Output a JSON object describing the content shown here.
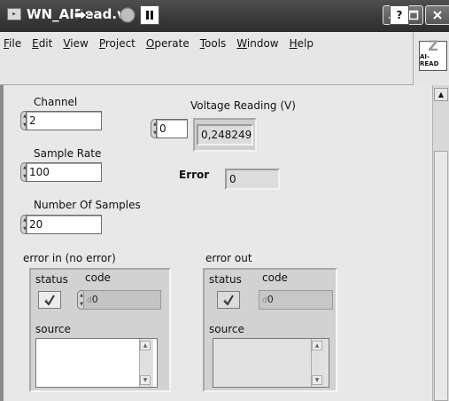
{
  "window": {
    "title": "WN_AIRead.vi",
    "app_icon_glyph": "▸"
  },
  "menu": {
    "items": [
      {
        "label": "File",
        "mnemonic": "F"
      },
      {
        "label": "Edit",
        "mnemonic": "E"
      },
      {
        "label": "View",
        "mnemonic": "V"
      },
      {
        "label": "Project",
        "mnemonic": "P"
      },
      {
        "label": "Operate",
        "mnemonic": "O"
      },
      {
        "label": "Tools",
        "mnemonic": "T"
      },
      {
        "label": "Window",
        "mnemonic": "W"
      },
      {
        "label": "Help",
        "mnemonic": "H"
      }
    ]
  },
  "toolbar": {
    "run_icon": "run-arrow-icon",
    "abort_icon": "abort-execution-icon",
    "pause_icon": "pause-icon",
    "help_glyph": "?"
  },
  "vi_icon": {
    "glyph": "Z",
    "caption": "AI-READ"
  },
  "controls": {
    "channel": {
      "label": "Channel",
      "value": "2"
    },
    "sample_rate": {
      "label": "Sample Rate",
      "value": "100"
    },
    "num_samples": {
      "label": "Number Of Samples",
      "value": "20"
    },
    "voltage": {
      "label": "Voltage Reading (V)",
      "index": "0",
      "value": "0,248249"
    },
    "error": {
      "label": "Error",
      "value": "0"
    }
  },
  "error_in": {
    "label": "error in (no error)",
    "status_label": "status",
    "code_label": "code",
    "code_prefix": "d",
    "code_value": "0",
    "source_label": "source",
    "source_value": ""
  },
  "error_out": {
    "label": "error out",
    "status_label": "status",
    "code_label": "code",
    "code_prefix": "d",
    "code_value": "0",
    "source_label": "source",
    "source_value": ""
  }
}
